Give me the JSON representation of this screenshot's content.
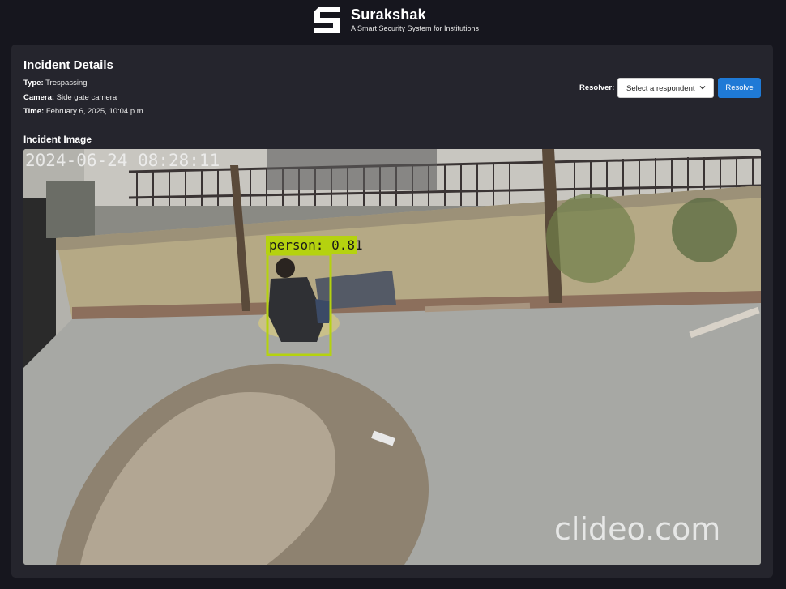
{
  "header": {
    "logo_icon": "shield-s-logo-icon",
    "app_name": "Surakshak",
    "tagline": "A Smart Security System for Institutions"
  },
  "incident": {
    "heading": "Incident Details",
    "type_label": "Type:",
    "type_value": "Trespassing",
    "camera_label": "Camera:",
    "camera_value": "Side gate camera",
    "time_label": "Time:",
    "time_value": "February 6, 2025, 10:04 p.m."
  },
  "resolver": {
    "label": "Resolver:",
    "select_value": "Select a respondent",
    "chevron_icon": "chevron-down-icon",
    "resolve_button": "Resolve"
  },
  "image_section": {
    "heading": "Incident Image",
    "camera_timestamp": "2024-06-24 08:28:11",
    "detection_label": "person: 0.81",
    "watermark": "clideo.com",
    "colors": {
      "detection_box": "#b5d20f",
      "accent_button": "#1f7ad6"
    }
  }
}
